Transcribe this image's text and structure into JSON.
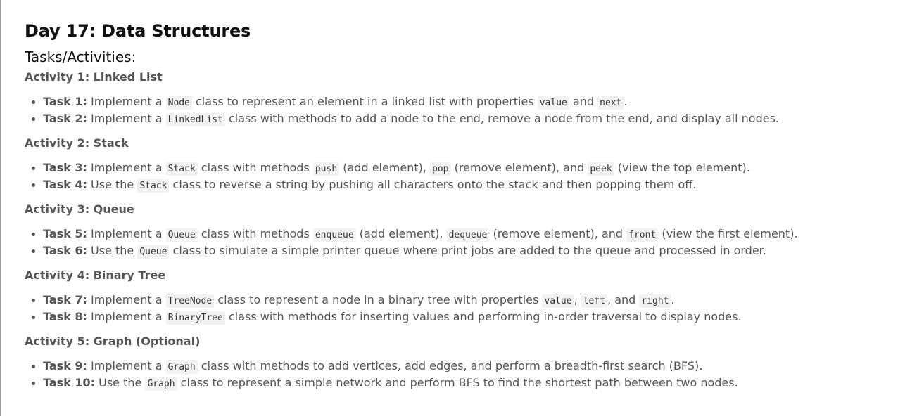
{
  "title": "Day 17: Data Structures",
  "subtitle": "Tasks/Activities:",
  "activities": [
    {
      "heading": "Activity 1: Linked List",
      "tasks": [
        {
          "label": "Task 1:",
          "parts": [
            {
              "t": " Implement a "
            },
            {
              "c": "Node"
            },
            {
              "t": " class to represent an element in a linked list with properties "
            },
            {
              "c": "value"
            },
            {
              "t": " and "
            },
            {
              "c": "next"
            },
            {
              "t": "."
            }
          ]
        },
        {
          "label": "Task 2:",
          "parts": [
            {
              "t": " Implement a "
            },
            {
              "c": "LinkedList"
            },
            {
              "t": " class with methods to add a node to the end, remove a node from the end, and display all nodes."
            }
          ]
        }
      ]
    },
    {
      "heading": "Activity 2: Stack",
      "tasks": [
        {
          "label": "Task 3:",
          "parts": [
            {
              "t": " Implement a "
            },
            {
              "c": "Stack"
            },
            {
              "t": " class with methods "
            },
            {
              "c": "push"
            },
            {
              "t": " (add element), "
            },
            {
              "c": "pop"
            },
            {
              "t": " (remove element), and "
            },
            {
              "c": "peek"
            },
            {
              "t": " (view the top element)."
            }
          ]
        },
        {
          "label": "Task 4:",
          "parts": [
            {
              "t": " Use the "
            },
            {
              "c": "Stack"
            },
            {
              "t": " class to reverse a string by pushing all characters onto the stack and then popping them off."
            }
          ]
        }
      ]
    },
    {
      "heading": "Activity 3: Queue",
      "tasks": [
        {
          "label": "Task 5:",
          "parts": [
            {
              "t": " Implement a "
            },
            {
              "c": "Queue"
            },
            {
              "t": " class with methods "
            },
            {
              "c": "enqueue"
            },
            {
              "t": " (add element), "
            },
            {
              "c": "dequeue"
            },
            {
              "t": " (remove element), and "
            },
            {
              "c": "front"
            },
            {
              "t": " (view the first element)."
            }
          ]
        },
        {
          "label": "Task 6:",
          "parts": [
            {
              "t": " Use the "
            },
            {
              "c": "Queue"
            },
            {
              "t": " class to simulate a simple printer queue where print jobs are added to the queue and processed in order."
            }
          ]
        }
      ]
    },
    {
      "heading": "Activity 4: Binary Tree",
      "tasks": [
        {
          "label": "Task 7:",
          "parts": [
            {
              "t": " Implement a "
            },
            {
              "c": "TreeNode"
            },
            {
              "t": " class to represent a node in a binary tree with properties "
            },
            {
              "c": "value"
            },
            {
              "t": ", "
            },
            {
              "c": "left"
            },
            {
              "t": ", and "
            },
            {
              "c": "right"
            },
            {
              "t": "."
            }
          ]
        },
        {
          "label": "Task 8:",
          "parts": [
            {
              "t": " Implement a "
            },
            {
              "c": "BinaryTree"
            },
            {
              "t": " class with methods for inserting values and performing in-order traversal to display nodes."
            }
          ]
        }
      ]
    },
    {
      "heading": "Activity 5: Graph (Optional)",
      "tasks": [
        {
          "label": "Task 9:",
          "parts": [
            {
              "t": " Implement a "
            },
            {
              "c": "Graph"
            },
            {
              "t": " class with methods to add vertices, add edges, and perform a breadth-first search (BFS)."
            }
          ]
        },
        {
          "label": "Task 10:",
          "parts": [
            {
              "t": " Use the "
            },
            {
              "c": "Graph"
            },
            {
              "t": " class to represent a simple network and perform BFS to find the shortest path between two nodes."
            }
          ]
        }
      ]
    }
  ]
}
